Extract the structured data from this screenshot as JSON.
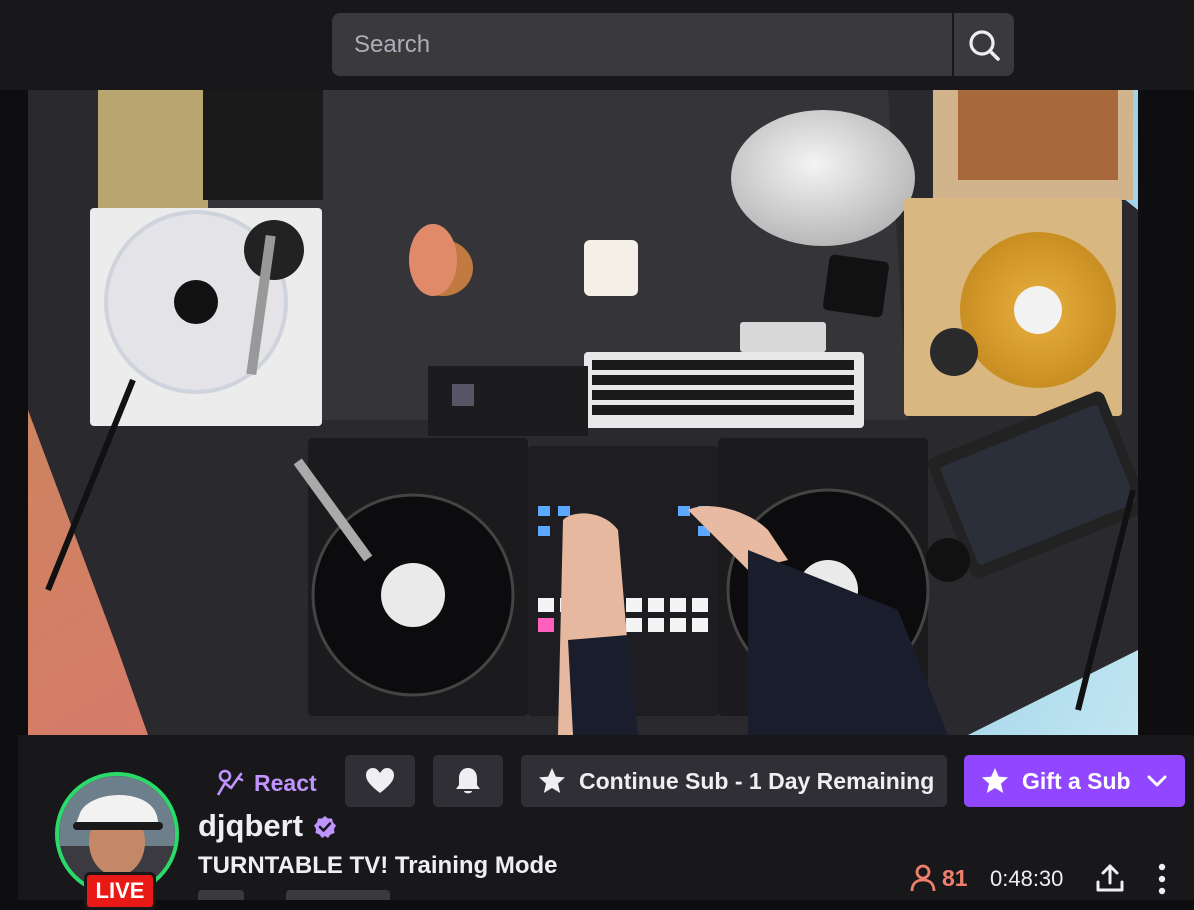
{
  "search": {
    "placeholder": "Search"
  },
  "icons": {
    "search": "search-icon",
    "react": "react-icon",
    "follow": "heart-icon",
    "notify": "bell-icon",
    "sub": "star-icon",
    "gift": "star-icon",
    "gift_menu": "chevron-down-icon",
    "viewers": "person-icon",
    "share": "share-icon",
    "more": "more-vertical-icon",
    "verified": "verified-badge-icon"
  },
  "actions": {
    "react_label": "React",
    "continue_sub_label": "Continue Sub - 1 Day Remaining",
    "gift_label": "Gift a Sub"
  },
  "channel": {
    "name": "djqbert",
    "live_label": "LIVE",
    "title": "TURNTABLE TV! Training Mode",
    "viewer_count": "81",
    "uptime": "0:48:30"
  },
  "colors": {
    "brand_purple": "#9147ff",
    "react_purple": "#bf94ff",
    "live_red": "#e91916",
    "live_ring_green": "#2bdb6a",
    "viewer_count": "#f07f6e"
  }
}
